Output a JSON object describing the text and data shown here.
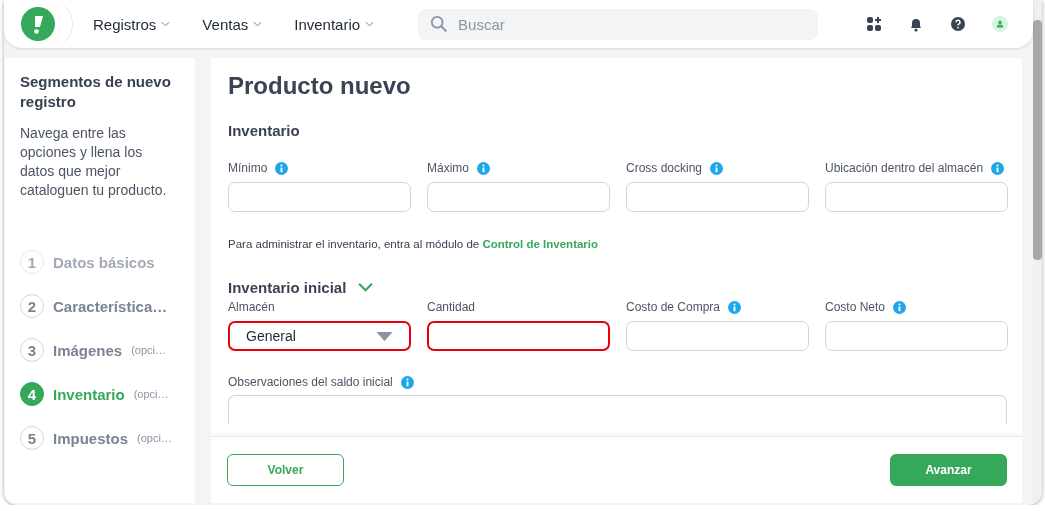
{
  "nav": {
    "menus": [
      {
        "label": "Registros"
      },
      {
        "label": "Ventas"
      },
      {
        "label": "Inventario"
      }
    ],
    "search": {
      "placeholder": "Buscar"
    }
  },
  "sidebar": {
    "title": "Segmentos de nuevo registro",
    "description": "Navega entre las opciones y llena los datos que mejor cataloguen tu producto.",
    "steps": [
      {
        "number": "1",
        "label": "Datos básicos",
        "selected": false,
        "disabled": true
      },
      {
        "number": "2",
        "label": "Característica…",
        "selected": false,
        "disabled": false
      },
      {
        "number": "3",
        "label": "Imágenes",
        "note": "(opci…",
        "selected": false,
        "disabled": false
      },
      {
        "number": "4",
        "label": "Inventario",
        "note": "(opci…",
        "selected": true,
        "disabled": false
      },
      {
        "number": "5",
        "label": "Impuestos",
        "note": "(opci…",
        "selected": false,
        "disabled": false
      }
    ]
  },
  "page": {
    "title": "Producto nuevo",
    "section": "Inventario",
    "fields": [
      {
        "label": "Mínimo",
        "info": true,
        "kind": "input",
        "error": false
      },
      {
        "label": "Máximo",
        "info": true,
        "kind": "input",
        "error": false
      },
      {
        "label": "Cross docking",
        "info": true,
        "kind": "input",
        "error": false
      },
      {
        "label": "Ubicación dentro del almacén",
        "info": true,
        "kind": "input",
        "error": false
      }
    ],
    "note": {
      "text": "Para administrar el inventario, entra al módulo de ",
      "link": "Control de Inventario"
    },
    "initial": {
      "title": "Inventario inicial",
      "expanded": true,
      "fields": [
        {
          "label": "Almacén",
          "kind": "select",
          "value": "General",
          "error": true
        },
        {
          "label": "Cantidad",
          "kind": "input",
          "error": true
        },
        {
          "label": "Costo de Compra",
          "info": true,
          "kind": "input",
          "error": false
        },
        {
          "label": "Costo Neto",
          "info": true,
          "kind": "input",
          "error": false
        }
      ],
      "observations": {
        "label": "Observaciones del saldo inicial",
        "info": true
      }
    }
  },
  "footer": {
    "back": "Volver",
    "next": "Avanzar"
  }
}
